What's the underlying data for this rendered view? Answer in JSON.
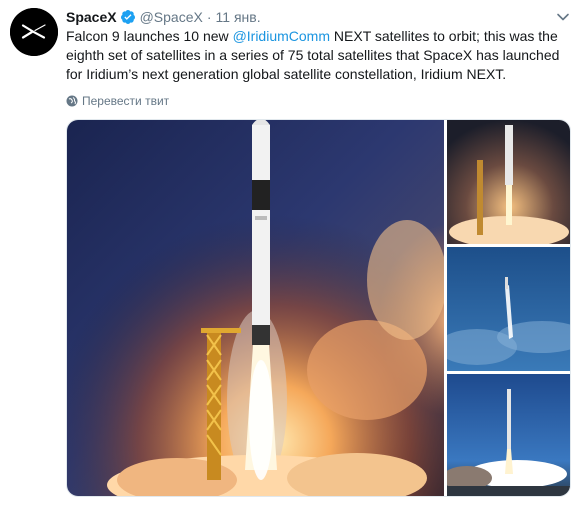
{
  "tweet": {
    "display_name": "SpaceX",
    "handle": "@SpaceX",
    "separator": "·",
    "date": "11 янв.",
    "text_before": "Falcon 9 launches 10 new ",
    "mention": "@IridiumComm",
    "text_after": " NEXT satellites to orbit; this was the eighth set of satellites in a series of 75 total satellites that SpaceX has launched for Iridium’s next generation global satellite constellation, Iridium NEXT.",
    "translate_label": "Перевести твит"
  },
  "icons": {
    "avatar": "spacex-logo-avatar",
    "verified": "verified-badge-icon",
    "caret": "chevron-down-icon",
    "translate": "globe-icon"
  },
  "colors": {
    "link": "#1b95e0",
    "muted": "#657786",
    "text": "#14171a",
    "verified": "#1da1f2"
  }
}
